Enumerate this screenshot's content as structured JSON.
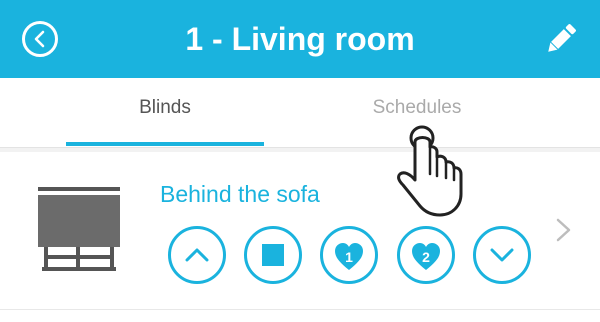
{
  "header": {
    "title": "1 - Living room",
    "back_icon": "chevron-left-circle-icon",
    "edit_icon": "pencil-icon",
    "bg_color": "#1ab3de"
  },
  "tabs": [
    {
      "label": "Blinds",
      "active": true
    },
    {
      "label": "Schedules",
      "active": false
    }
  ],
  "blind": {
    "name": "Behind the sofa",
    "icon": "blind-icon",
    "controls": [
      {
        "action": "up",
        "icon": "chevron-up-icon"
      },
      {
        "action": "stop",
        "icon": "stop-icon"
      },
      {
        "action": "favorite-1",
        "icon": "heart-icon",
        "label": "1"
      },
      {
        "action": "favorite-2",
        "icon": "heart-icon",
        "label": "2"
      },
      {
        "action": "down",
        "icon": "chevron-down-icon"
      }
    ],
    "detail_icon": "chevron-right-icon"
  },
  "cursor": {
    "icon": "pointing-hand-icon"
  }
}
